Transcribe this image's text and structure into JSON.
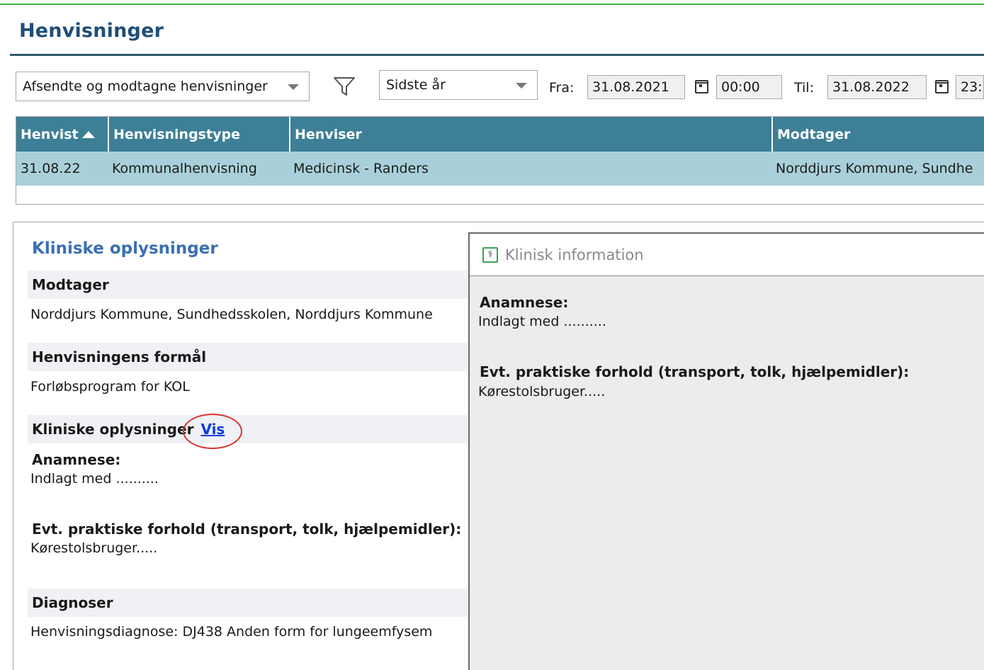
{
  "page": {
    "title": "Henvisninger"
  },
  "toolbar": {
    "type_filter": "Afsendte og modtagne henvisninger",
    "period": "Sidste år",
    "from_label": "Fra:",
    "from_date": "31.08.2021",
    "from_time": "00:00",
    "to_label": "Til:",
    "to_date": "31.08.2022",
    "to_time": "23:"
  },
  "table": {
    "columns": [
      "Henvist",
      "Henvisningstype",
      "Henviser",
      "Modtager"
    ],
    "rows": [
      [
        "31.08.22",
        "Kommunalhenvisning",
        "Medicinsk - Randers",
        "Norddjurs Kommune, Sundhe"
      ]
    ]
  },
  "detail": {
    "section_title": "Kliniske oplysninger",
    "recipient_heading": "Modtager",
    "recipient_value": "Norddjurs Kommune, Sundhedsskolen, Norddjurs Kommune",
    "purpose_heading": "Henvisningens formål",
    "purpose_value": "Forløbsprogram for KOL",
    "clinical_heading": "Kliniske oplysninger",
    "clinical_link": "Vis",
    "anamnese_label": "Anamnese:",
    "anamnese_value": "Indlagt med ..........",
    "practical_label": "Evt. praktiske forhold (transport, tolk, hjælpemidler):",
    "practical_value": "Kørestolsbruger.....",
    "diagnoses_heading": "Diagnoser",
    "diagnoses_value": "Henvisningsdiagnose: DJ438 Anden form for lungeemfysem"
  },
  "clinical_panel": {
    "title": "Klinisk information",
    "icon_glyph": "⚕",
    "anamnese_label": "Anamnese:",
    "anamnese_value": "Indlagt med ..........",
    "practical_label": "Evt. praktiske forhold (transport, tolk, hjælpemidler):",
    "practical_value": "Kørestolsbruger....."
  },
  "colors": {
    "header_bg": "#3d7f96",
    "selected_row_bg": "#a9d0da",
    "title_color": "#1f4e79",
    "section_title_color": "#3a6fb4",
    "link_color": "#0b3ddc",
    "highlight_circle": "#d9352a"
  }
}
